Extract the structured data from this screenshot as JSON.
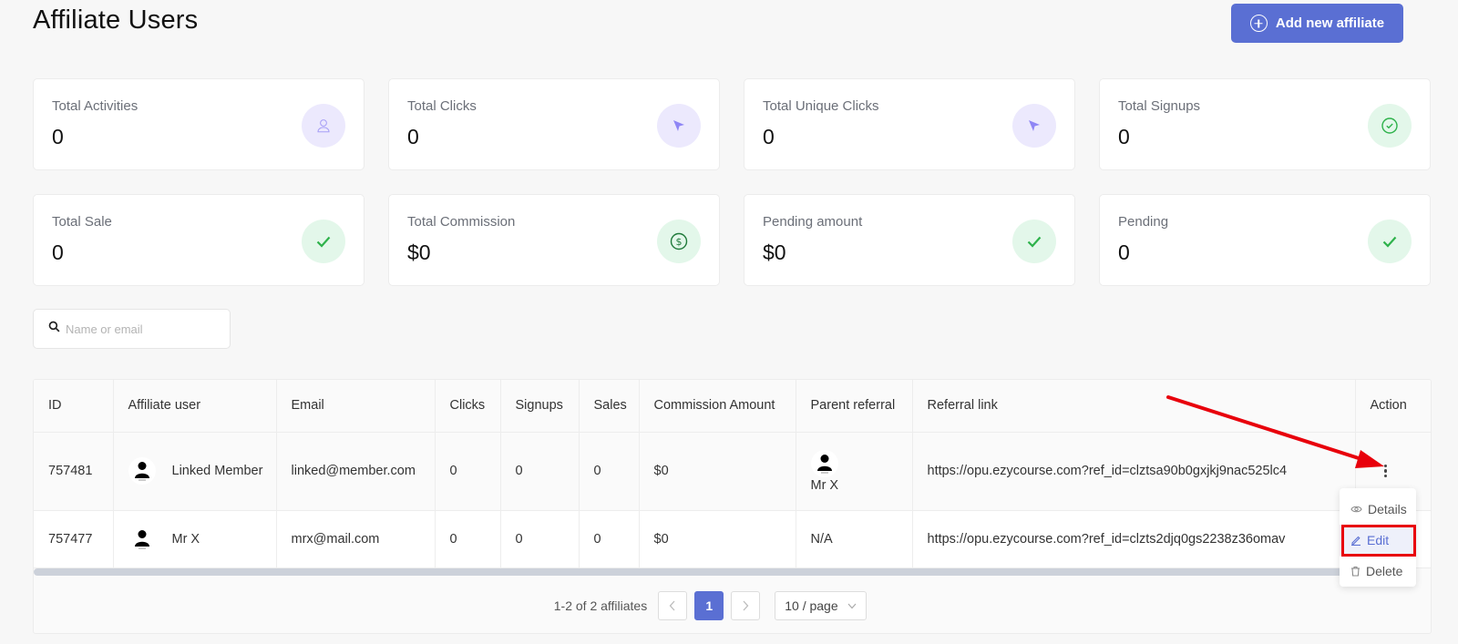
{
  "header": {
    "title": "Affiliate Users",
    "add_button_label": "Add new affiliate"
  },
  "stats": [
    {
      "label": "Total Activities",
      "value": "0",
      "icon": "user-icon",
      "tone": "purple"
    },
    {
      "label": "Total Clicks",
      "value": "0",
      "icon": "cursor-pointer-icon",
      "tone": "purple"
    },
    {
      "label": "Total Unique Clicks",
      "value": "0",
      "icon": "cursor-pointer-icon",
      "tone": "purple"
    },
    {
      "label": "Total Signups",
      "value": "0",
      "icon": "check-circle-icon",
      "tone": "green"
    },
    {
      "label": "Total Sale",
      "value": "0",
      "icon": "check-icon",
      "tone": "green"
    },
    {
      "label": "Total Commission",
      "value": "$0",
      "icon": "dollar-circle-icon",
      "tone": "green"
    },
    {
      "label": "Pending amount",
      "value": "$0",
      "icon": "check-icon",
      "tone": "green"
    },
    {
      "label": "Pending",
      "value": "0",
      "icon": "check-icon",
      "tone": "green"
    }
  ],
  "search": {
    "placeholder": "Name or email",
    "value": ""
  },
  "table": {
    "columns": [
      "ID",
      "Affiliate user",
      "Email",
      "Clicks",
      "Signups",
      "Sales",
      "Commission Amount",
      "Parent referral",
      "Referral link",
      "Action"
    ],
    "rows": [
      {
        "id": "757481",
        "name": "Linked Member",
        "email": "linked@member.com",
        "clicks": "0",
        "signups": "0",
        "sales": "0",
        "commission": "$0",
        "parent_referral": "Mr X",
        "referral_link": "https://opu.ezycourse.com?ref_id=clztsa90b0gxjkj9nac525lc4"
      },
      {
        "id": "757477",
        "name": "Mr X",
        "email": "mrx@mail.com",
        "clicks": "0",
        "signups": "0",
        "sales": "0",
        "commission": "$0",
        "parent_referral": "N/A",
        "referral_link": "https://opu.ezycourse.com?ref_id=clzts2djq0gs2238z36omav"
      }
    ]
  },
  "pagination": {
    "summary": "1-2 of 2 affiliates",
    "current_page": "1",
    "prev_label": "<",
    "next_label": ">",
    "page_size": "10 / page"
  },
  "action_menu": {
    "items": [
      {
        "label": "Details",
        "icon": "eye-icon"
      },
      {
        "label": "Edit",
        "icon": "pencil-icon",
        "highlighted": true
      },
      {
        "label": "Delete",
        "icon": "trash-icon"
      }
    ]
  },
  "colors": {
    "accent": "#5a6fd3",
    "annotation": "#e8000b",
    "success": "#2eb24b",
    "purple_icon": "#8f86f5"
  }
}
